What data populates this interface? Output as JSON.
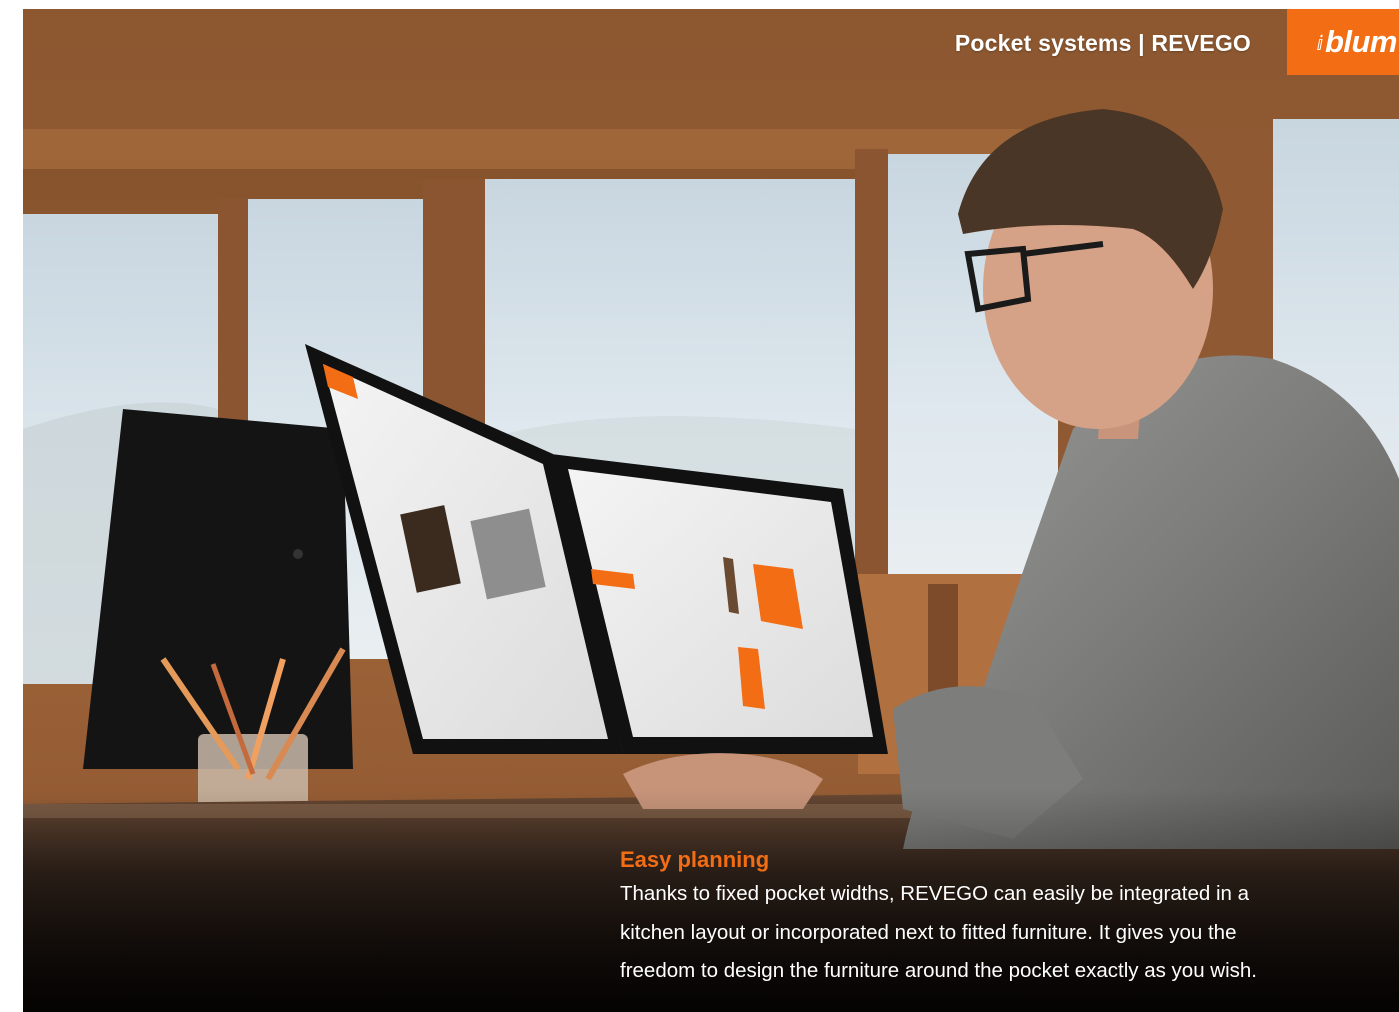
{
  "header": {
    "title": "Pocket systems | REVEGO"
  },
  "brand": {
    "logo_text": "blum",
    "accent_color": "#f26d14"
  },
  "caption": {
    "title": "Easy planning",
    "body_lines": [
      "Thanks to fixed pocket widths, REVEGO can easily be integrated in a",
      "kitchen layout or incorporated next to fitted furniture. It gives you the",
      "freedom to design the furniture around the pocket exactly as you wish."
    ]
  }
}
